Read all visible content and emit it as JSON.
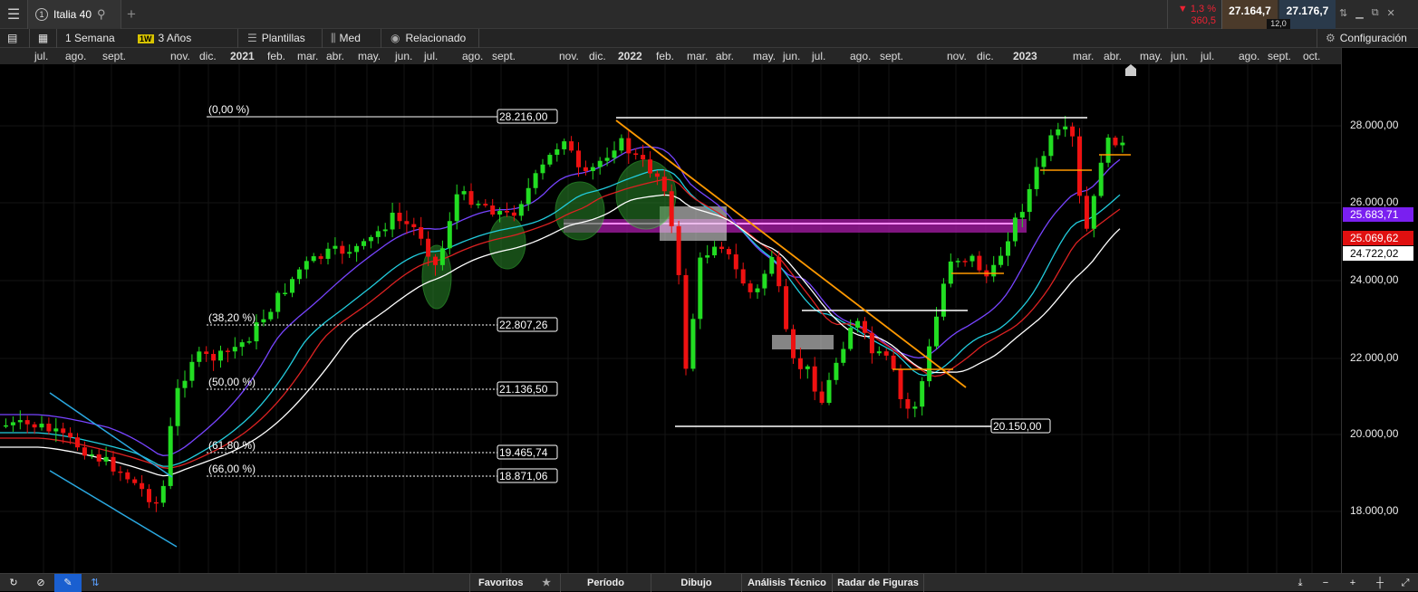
{
  "topbar": {
    "tab_number": "1",
    "instrument": "Italia 40",
    "change_pct": "▼ 1,3 %",
    "change_pts": "360,5",
    "bid": "27.164,7",
    "ask": "27.176,7",
    "spread": "12,0"
  },
  "toolbar": {
    "interval": "1 Semana",
    "interval_badge": "1W",
    "range": "3 Años",
    "templates": "Plantillas",
    "average": "Med",
    "related": "Relacionado",
    "settings": "Configuración"
  },
  "time_axis": {
    "labels": [
      "jul.",
      "ago.",
      "sept.",
      "nov.",
      "dic.",
      "2021",
      "feb.",
      "mar.",
      "abr.",
      "may.",
      "jun.",
      "jul.",
      "ago.",
      "sept.",
      "nov.",
      "dic.",
      "2022",
      "feb.",
      "mar.",
      "abr.",
      "may.",
      "jun.",
      "jul.",
      "ago.",
      "sept.",
      "nov.",
      "dic.",
      "2023",
      "mar.",
      "abr.",
      "may.",
      "jun.",
      "jul.",
      "ago.",
      "sept.",
      "oct."
    ]
  },
  "price_axis": {
    "labels": [
      "28.000,00",
      "26.000,00",
      "24.000,00",
      "22.000,00",
      "20.000,00",
      "18.000,00"
    ],
    "badges": [
      {
        "text": "25.683,71",
        "color": "#7a1ff0"
      },
      {
        "text": "25.069,62",
        "color": "#e01010"
      },
      {
        "text": "24.722,02",
        "color": "#ffffff"
      }
    ]
  },
  "fibonacci": {
    "levels": [
      {
        "pct": "(0,00 %)",
        "price": "28.216,00"
      },
      {
        "pct": "(38,20 %)",
        "price": "22.807,26"
      },
      {
        "pct": "(50,00 %)",
        "price": "21.136,50"
      },
      {
        "pct": "(61,80 %)",
        "price": "19.465,74"
      },
      {
        "pct": "(66,00 %)",
        "price": "18.871,06"
      }
    ],
    "low_label": "20.150,00"
  },
  "bottombar": {
    "favorites": "Favoritos",
    "period": "Período",
    "drawing": "Dibujo",
    "technical": "Análisis Técnico",
    "patterns": "Radar de Figuras"
  },
  "colors": {
    "up": "#22dd22",
    "down": "#ee1111",
    "purple_ma": "#7744ff",
    "cyan_ma": "#22ccdd",
    "red_ma": "#dd2222",
    "white_ma": "#ffffff",
    "trend": "#ff9900"
  }
}
